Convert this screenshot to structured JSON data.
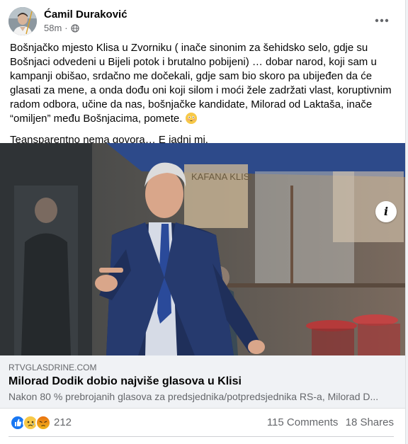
{
  "post": {
    "author": "Ćamil Duraković",
    "time": "58m",
    "audience_icon": "globe-icon",
    "more_icon": "more-horizontal-icon",
    "paragraph1": "Bošnjačko mjesto Klisa u Zvorniku ( inače sinonim za šehidsko selo, gdje su Bošnjaci odvedeni u Bijeli potok i brutalno pobijeni) … dobar narod, koji sam u kampanji obišao, srdačno me dočekali, gdje sam bio skoro pa ubijeđen da će glasati za mene, a onda dođu oni koji silom i moći žele zadržati vlast, koruptivnim radom odbora, učine da nas, bošnjačke kandidate,  Milorad od Laktaša, inače “omiljen” među Bošnjacima, pomete.",
    "paragraph1_emoji": "flushed-face-emoji",
    "paragraph2": "Teanspareпtno nema govora… E jadni mi."
  },
  "link": {
    "domain": "RTVGLASDRINE.COM",
    "title": "Milorad Dodik dobio najviše glasova u Klisi",
    "description": "Nakon 80 % prebrojanih glasova za predsjednika/potpredsjednika RS-a, Milorad D...",
    "info_label": "i",
    "sign_text": "KAFANA KLISI"
  },
  "engagement": {
    "reaction_icons": [
      "like-icon",
      "sad-icon",
      "angry-icon"
    ],
    "reaction_count": "212",
    "comments": "115 Comments",
    "shares": "18 Shares"
  },
  "colors": {
    "text": "#050505",
    "secondary": "#65676b",
    "link_bg": "#f0f2f5",
    "like_blue": "#1877f2",
    "awning_blue": "#2d4a8a"
  }
}
